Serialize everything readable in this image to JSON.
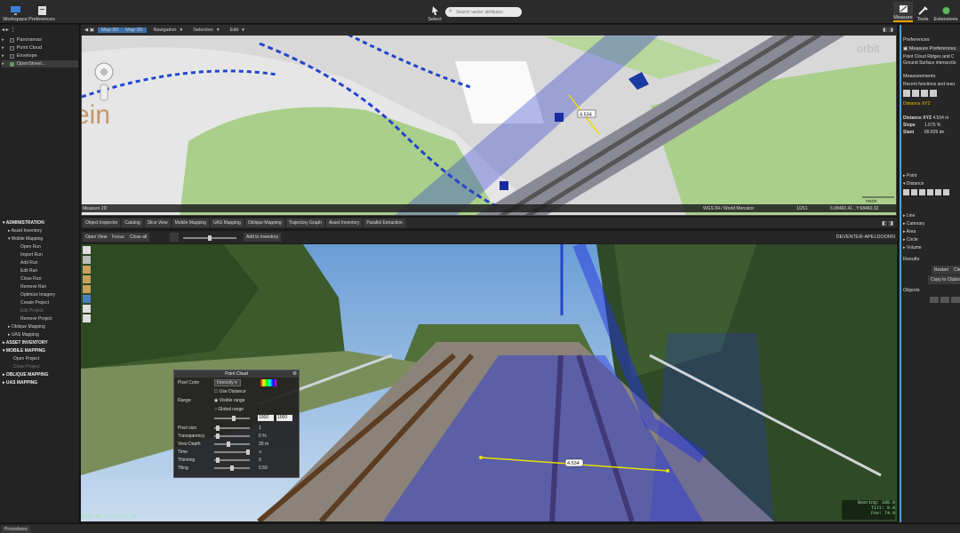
{
  "topbar": {
    "workspace": "Workspace",
    "preferences": "Preferences",
    "select": "Select",
    "search_placeholder": "Search vector attributes",
    "measure": "Measure",
    "tools": "Tools",
    "extensions": "Extensions"
  },
  "layers": [
    "Panoramas",
    "Point Cloud",
    "Envelope",
    "OpenStreet..."
  ],
  "tree": {
    "administration": "ADMINISTRATION",
    "asset_inventory": "Asset Inventory",
    "mobile_mapping": "Mobile Mapping",
    "mm_items": [
      "Open Run",
      "Import Run",
      "Add Run",
      "Edit Run",
      "Close Run",
      "Remove Run",
      "Optimize Imagery",
      "Create Project",
      "Edit Project",
      "Remove Project"
    ],
    "oblique_mapping": "Oblique Mapping",
    "uas_mapping": "UAS Mapping",
    "asset_inventory_cap": "ASSET INVENTORY",
    "mobile_mapping_cap": "MOBILE MAPPING",
    "mm2_items": [
      "Open Project",
      "Close Project"
    ],
    "oblique_mapping_cap": "OBLIQUE MAPPING",
    "uas_mapping_cap": "UAS MAPPING"
  },
  "map": {
    "tabs": [
      "Map 2D",
      "Map 3D",
      "Navigation",
      "Selection",
      "Edit"
    ],
    "label_orbit": "orbit",
    "label_ein": "ein",
    "measure_value": "4.534",
    "status_left": "Measure 2D",
    "status_crs": "WGS 84 / World Mercator",
    "status_scale": "1/261",
    "status_coords": "6.08460.41 , Y:68460.32",
    "scale_label": "meter"
  },
  "viewtabs": [
    "Object Inspector",
    "Catalog",
    "Slice View",
    "Mobile Mapping",
    "UAS Mapping",
    "Oblique Mapping",
    "Trajectory Graph",
    "Asset Inventory",
    "Parallel Extraction"
  ],
  "viewbar": {
    "open_view": "Open View",
    "focus": "Focus",
    "close_all": "Close all",
    "add_inventory": "Add to inventory",
    "location": "DEVENTER-APELDOORN"
  },
  "photo": {
    "measure_value": "4.534",
    "timestamp": "2017-06-17 13:33:14",
    "coords": "Bearing: 180.0\nTilt: 0.0\nFov: 74.9"
  },
  "pointcloud": {
    "title": "Point Cloud",
    "pixel_color": "Pixel Color",
    "pixel_color_value": "Intensity",
    "use_distance": "Use Distance",
    "range": "Range",
    "visible_range": "Visible range",
    "global_range": "Global range",
    "range_min": "1000",
    "range_max": "1000",
    "pixel_size": "Pixel size",
    "pixel_size_value": "1",
    "transparency": "Transparency",
    "transparency_value": "0 %",
    "view_depth": "View Depth",
    "view_depth_value": "30 m",
    "time": "Time",
    "time_value": "∞",
    "thinning": "Thinning",
    "thinning_value": "0",
    "tiling": "Tiling",
    "tiling_value": "0.50"
  },
  "right": {
    "preferences": "Preferences",
    "measure_prefs": "Measure Preferences",
    "desc": "Point Cloud Ridges and C Ground Surface intersectio",
    "measurements": "Measurements",
    "recent": "Recent functions and resu",
    "distance_xyz": "Distance XYZ",
    "dist_label": "Distance XYZ",
    "dist_value": "4.534 m",
    "slope_label": "Slope",
    "slope_value": "1.675 %",
    "slant_label": "Slant",
    "slant_value": "89.825 de",
    "point": "Point",
    "distance": "Distance",
    "line": "Line",
    "catenary": "Catenary",
    "area": "Area",
    "circle": "Circle",
    "volume": "Volume",
    "results": "Results",
    "restart": "Restart",
    "clear": "Clea",
    "copy_clipboard": "Copy to Clipbo",
    "objects": "Objects"
  },
  "bottom": {
    "procedures": "Procedures"
  },
  "colors": {
    "accent": "#4aa3df",
    "pointcloud": "#2233dd",
    "measure": "#e8e000"
  }
}
